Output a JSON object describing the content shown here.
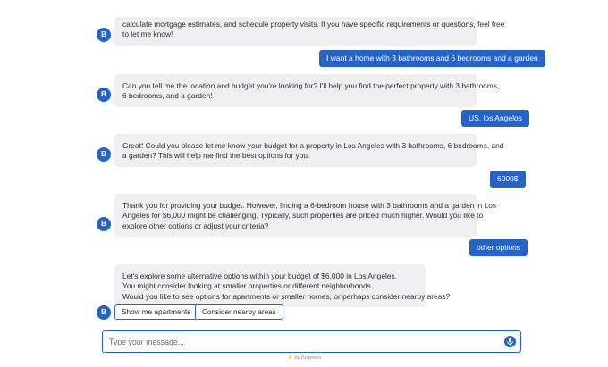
{
  "messages": {
    "m1_lines": [
      "calculate mortgage estimates, and schedule property visits. If you have specific requirements or questions, feel free",
      "to let me know!"
    ],
    "u1": "I want a home with 3 bathrooms and 6 bedrooms and a garden",
    "m2_lines": [
      "Can you tell me the location and budget you're looking for? I'll help you find the perfect property with 3 bathrooms,",
      "6 bedrooms, and a garden!"
    ],
    "u2": "US, los Angelos",
    "m3_lines": [
      "Great! Could you please let me know your budget for a property in Los Angeles with 3 bathrooms, 6 bedrooms, and",
      "a garden? This will help me find the best options for you."
    ],
    "u3": "6000$",
    "m4_lines": [
      "Thank you for providing your budget. However, finding a 6-bedroom house with 3 bathrooms and a garden in Los",
      "Angeles for $6,000 might be challenging. Typically, such properties are priced much higher. Would you like to",
      "explore other options or adjust your criteria?"
    ],
    "u4": "other options",
    "m5_lines": [
      "Let's explore some alternative options within your budget of $6,000 in Los Angeles.",
      "You might consider looking at smaller properties or different neighborhoods.",
      "Would you like to see options for apartments or smaller homes, or perhaps consider nearby areas?"
    ]
  },
  "avatar_letter": "B",
  "quick_replies": [
    "Show me apartments",
    "Consider nearby areas"
  ],
  "composer": {
    "placeholder": "Type your message..."
  },
  "footer": {
    "bolt": "⚡",
    "text": "by Botpress"
  },
  "colors": {
    "accent": "#2563c9",
    "bot_bubble": "#efeff1"
  },
  "icons": {
    "mic": "mic-icon",
    "cursor": "mouse-pointer-icon"
  }
}
